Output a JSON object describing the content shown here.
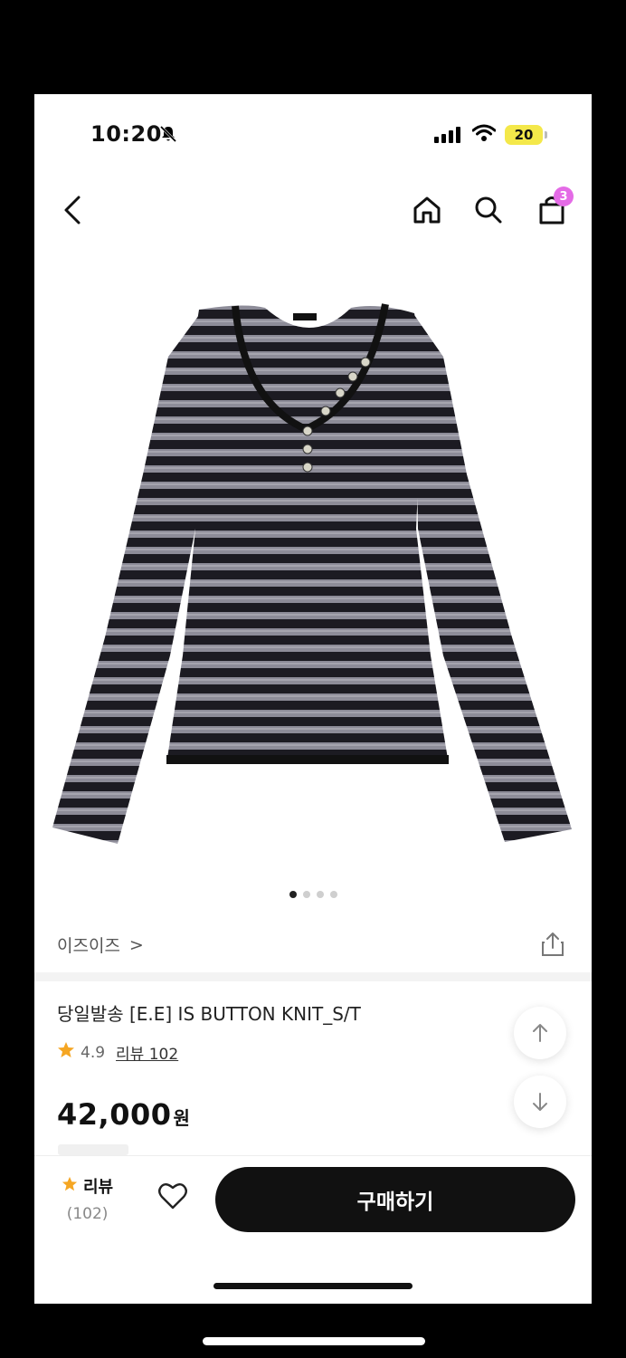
{
  "status_bar": {
    "time": "10:20",
    "battery": "20"
  },
  "nav": {
    "cart_count": "3"
  },
  "gallery": {
    "total_images": 4,
    "active_index": 0
  },
  "product": {
    "brand": "이즈이즈",
    "brand_chevron": ">",
    "title": "당일발송 [E.E] IS BUTTON KNIT_S/T",
    "rating": "4.9",
    "review_link": "리뷰 102",
    "price": "42,000",
    "currency": "원"
  },
  "bottom_bar": {
    "review_label": "리뷰",
    "review_count": "(102)",
    "buy_label": "구매하기"
  },
  "colors": {
    "accent_badge": "#e46be6",
    "star": "#f5a623",
    "battery": "#f4e84a"
  }
}
